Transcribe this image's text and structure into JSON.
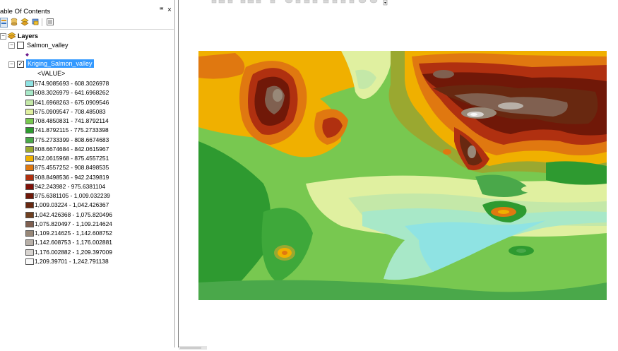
{
  "toc": {
    "title": "able Of Contents",
    "pin_glyph": "ⱎ",
    "close_glyph": "×",
    "toolbar_icons": [
      "list-by-drawing-order-icon",
      "list-by-source-icon",
      "list-by-visibility-icon",
      "list-by-selection-icon",
      "options-icon"
    ],
    "layers_label": "Layers",
    "layer1": {
      "name": "Salmon_valley",
      "checked": false
    },
    "layer2": {
      "name": "Kriging_Salmon_valley",
      "checked": true,
      "field": "<VALUE>"
    },
    "legend": [
      {
        "label": "574.9085693 - 608.3026978",
        "color": "#8fe3e3"
      },
      {
        "label": "608.3026979 - 641.6968262",
        "color": "#a8e8c8"
      },
      {
        "label": "641.6968263 - 675.0909546",
        "color": "#c4e8a8"
      },
      {
        "label": "675.0909547 - 708.485083",
        "color": "#e0f0a0"
      },
      {
        "label": "708.4850831 - 741.8792114",
        "color": "#78c850"
      },
      {
        "label": "741.8792115 - 775.2733398",
        "color": "#2e9a30"
      },
      {
        "label": "775.2733399 - 808.6674683",
        "color": "#4aa84a"
      },
      {
        "label": "808.6674684 - 842.0615967",
        "color": "#9aa830"
      },
      {
        "label": "842.0615968 - 875.4557251",
        "color": "#f0b000"
      },
      {
        "label": "875.4557252 - 908.8498535",
        "color": "#e07810"
      },
      {
        "label": "908.8498536 - 942.2439819",
        "color": "#b03010"
      },
      {
        "label": "942.243982 - 975.6381104",
        "color": "#801008"
      },
      {
        "label": "975.6381105 - 1,009.032239",
        "color": "#701808"
      },
      {
        "label": "1,009.03224 - 1,042.426367",
        "color": "#682810"
      },
      {
        "label": "1,042.426368 - 1,075.820496",
        "color": "#704020"
      },
      {
        "label": "1,075.820497 - 1,109.214624",
        "color": "#806050"
      },
      {
        "label": "1,109.214625 - 1,142.608752",
        "color": "#988878"
      },
      {
        "label": "1,142.608753 - 1,176.002881",
        "color": "#b8b0a8"
      },
      {
        "label": "1,176.002882 - 1,209.397009",
        "color": "#d8d4d0"
      },
      {
        "label": "1,209.39701 - 1,242.791138",
        "color": "#f8f8f8"
      }
    ]
  }
}
